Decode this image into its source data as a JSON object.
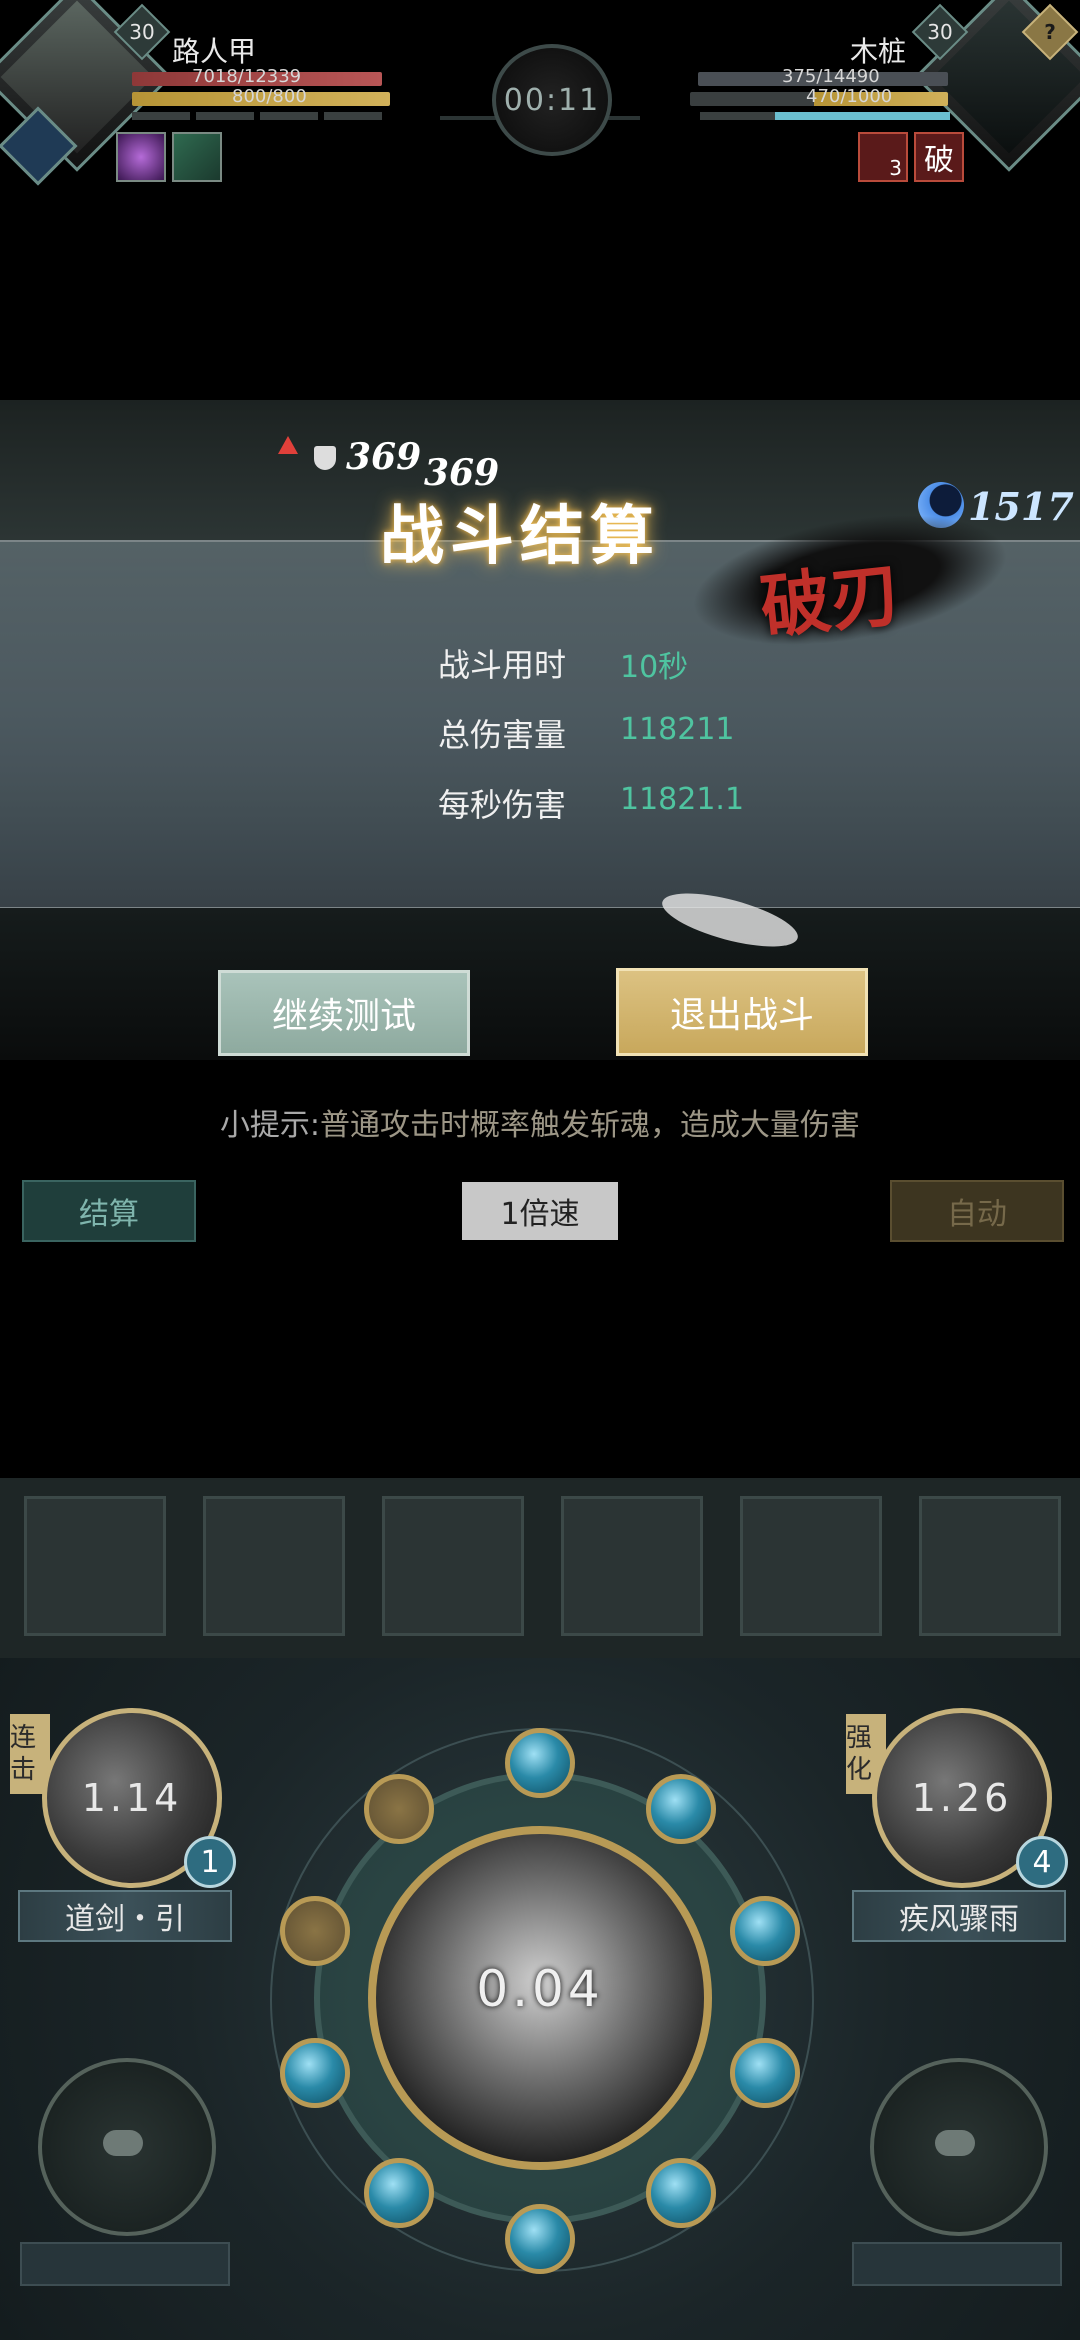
{
  "player": {
    "name": "路人甲",
    "level": "30",
    "hp": "7018/12339",
    "mp": "800/800",
    "hp_color": "#b04040",
    "mp_color": "#c8a040"
  },
  "enemy": {
    "name": "木桩",
    "level": "30",
    "hp": "375/14490",
    "mp": "470/1000",
    "help": "?",
    "buff_stack": "3",
    "buff_label": "破"
  },
  "timer": "00:11",
  "floating": {
    "buff_damage": "369",
    "hit_damage": "369",
    "currency": "1517"
  },
  "result": {
    "title": "战斗结算",
    "stamp": "破刃",
    "stats": [
      {
        "label": "战斗用时",
        "value": "10秒"
      },
      {
        "label": "总伤害量",
        "value": "118211"
      },
      {
        "label": "每秒伤害",
        "value": "11821.1"
      }
    ],
    "continue_label": "继续测试",
    "exit_label": "退出战斗"
  },
  "tip": {
    "prefix": "小提示:",
    "text": "普通攻击时概率触发斩魂，造成大量伤害"
  },
  "controls": {
    "settle": "结算",
    "speed": "1倍速",
    "auto": "自动"
  },
  "skills": {
    "left": {
      "tag": "连击",
      "cooldown": "1.14",
      "count": "1",
      "name": "道剑・引"
    },
    "right": {
      "tag": "强化",
      "cooldown": "1.26",
      "count": "4",
      "name": "疾风骤雨"
    },
    "center_cooldown": "0.04"
  }
}
